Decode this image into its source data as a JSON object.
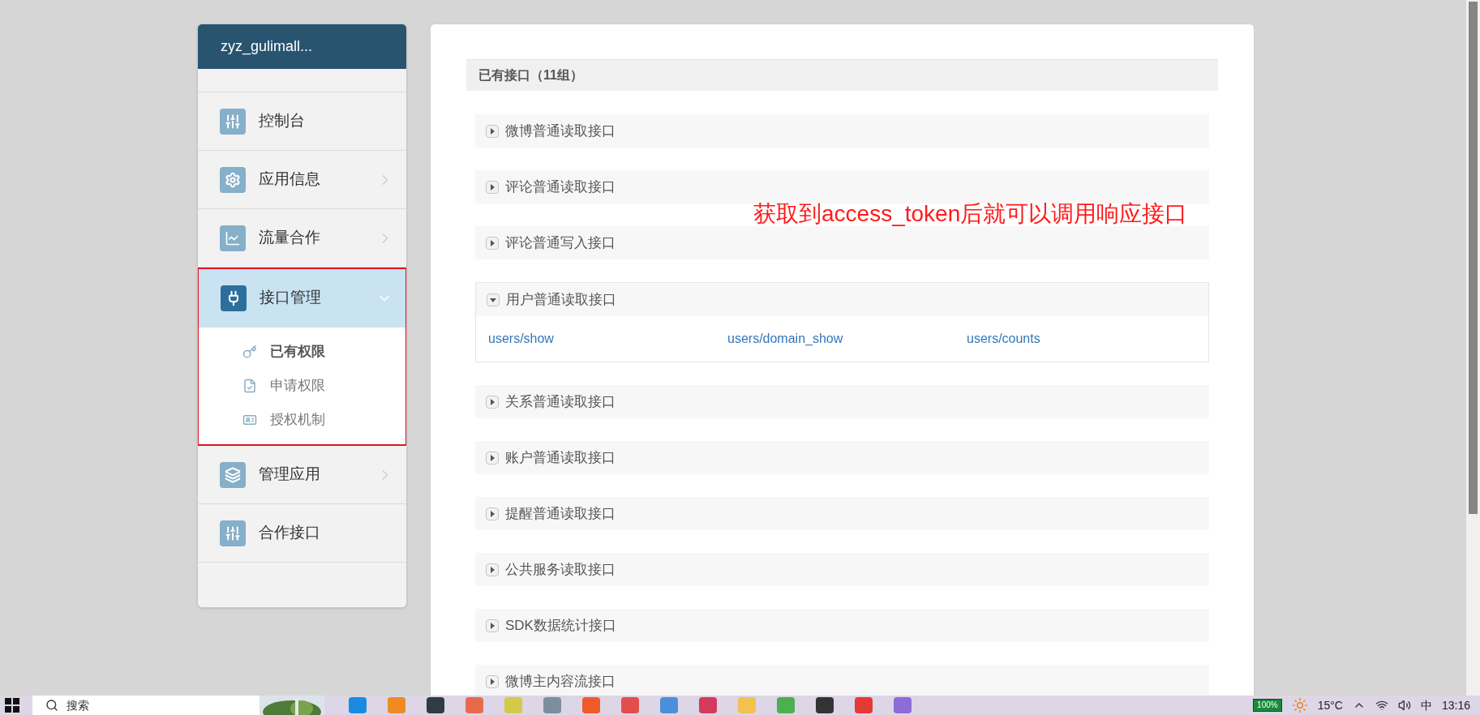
{
  "sidebar": {
    "title": "zyz_gulimall...",
    "items": [
      {
        "label": "控制台",
        "kind": "sliders",
        "selected": false,
        "outlined": false
      },
      {
        "label": "应用信息",
        "kind": "gear",
        "expanded": false,
        "selected": false,
        "outlined": false
      },
      {
        "label": "流量合作",
        "kind": "chart",
        "expanded": false,
        "selected": false,
        "outlined": false
      },
      {
        "label": "接口管理",
        "kind": "plug",
        "expanded": true,
        "selected": true,
        "outlined": true,
        "children": [
          {
            "label": "已有权限",
            "kind": "key",
            "selected": true
          },
          {
            "label": "申请权限",
            "kind": "doc",
            "selected": false
          },
          {
            "label": "授权机制",
            "kind": "card",
            "selected": false
          }
        ]
      },
      {
        "label": "管理应用",
        "kind": "layers",
        "expanded": false,
        "selected": false,
        "outlined": false
      },
      {
        "label": "合作接口",
        "kind": "sliders",
        "selected": false,
        "outlined": false
      }
    ]
  },
  "content": {
    "heading": "已有接口（11组）",
    "annotation": "获取到access_token后就可以调用响应接口",
    "groups": [
      {
        "label": "微博普通读取接口",
        "expanded": false
      },
      {
        "label": "评论普通读取接口",
        "expanded": false
      },
      {
        "label": "评论普通写入接口",
        "expanded": false
      },
      {
        "label": "用户普通读取接口",
        "expanded": true,
        "links": [
          "users/show",
          "users/domain_show",
          "users/counts"
        ]
      },
      {
        "label": "关系普通读取接口",
        "expanded": false
      },
      {
        "label": "账户普通读取接口",
        "expanded": false
      },
      {
        "label": "提醒普通读取接口",
        "expanded": false
      },
      {
        "label": "公共服务读取接口",
        "expanded": false
      },
      {
        "label": "SDK数据统计接口",
        "expanded": false
      },
      {
        "label": "微博主内容流接口",
        "expanded": false
      }
    ]
  },
  "taskbar": {
    "search_placeholder": "搜索",
    "battery": "100%",
    "weather": "15°C",
    "input_method": "中",
    "time": "13:16"
  }
}
